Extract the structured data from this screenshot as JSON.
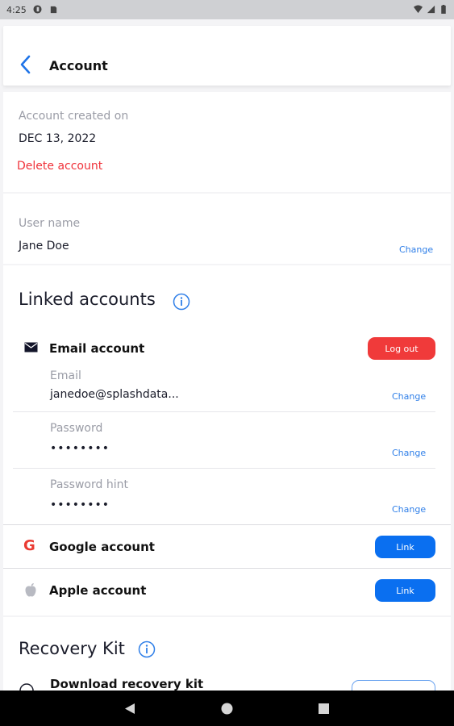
{
  "status_bar": {
    "time": "4:25"
  },
  "header": {
    "title": "Account"
  },
  "account": {
    "created_label": "Account created on",
    "created_value": "DEC 13, 2022",
    "delete_label": "Delete account"
  },
  "username": {
    "label": "User name",
    "value": "Jane Doe",
    "change_label": "Change"
  },
  "linked": {
    "heading": "Linked accounts",
    "email_account": {
      "title": "Email account",
      "logout_label": "Log out",
      "email_label": "Email",
      "email_value": "janedoe@splashdata...",
      "email_change": "Change",
      "password_label": "Password",
      "password_value": "••••••••",
      "password_change": "Change",
      "hint_label": "Password hint",
      "hint_value": "••••••••",
      "hint_change": "Change"
    },
    "google": {
      "title": "Google account",
      "link_label": "Link"
    },
    "apple": {
      "title": "Apple account",
      "link_label": "Link"
    }
  },
  "recovery": {
    "heading": "Recovery Kit",
    "download_label": "Download recovery kit"
  },
  "colors": {
    "accent_blue": "#0a6ff0",
    "danger_red": "#f03a3a",
    "link_blue": "#2f7fe8"
  },
  "icons": [
    "back-chevron-icon",
    "info-icon",
    "mail-icon",
    "google-icon",
    "apple-icon",
    "nav-back-icon",
    "nav-home-icon",
    "nav-recents-icon"
  ]
}
